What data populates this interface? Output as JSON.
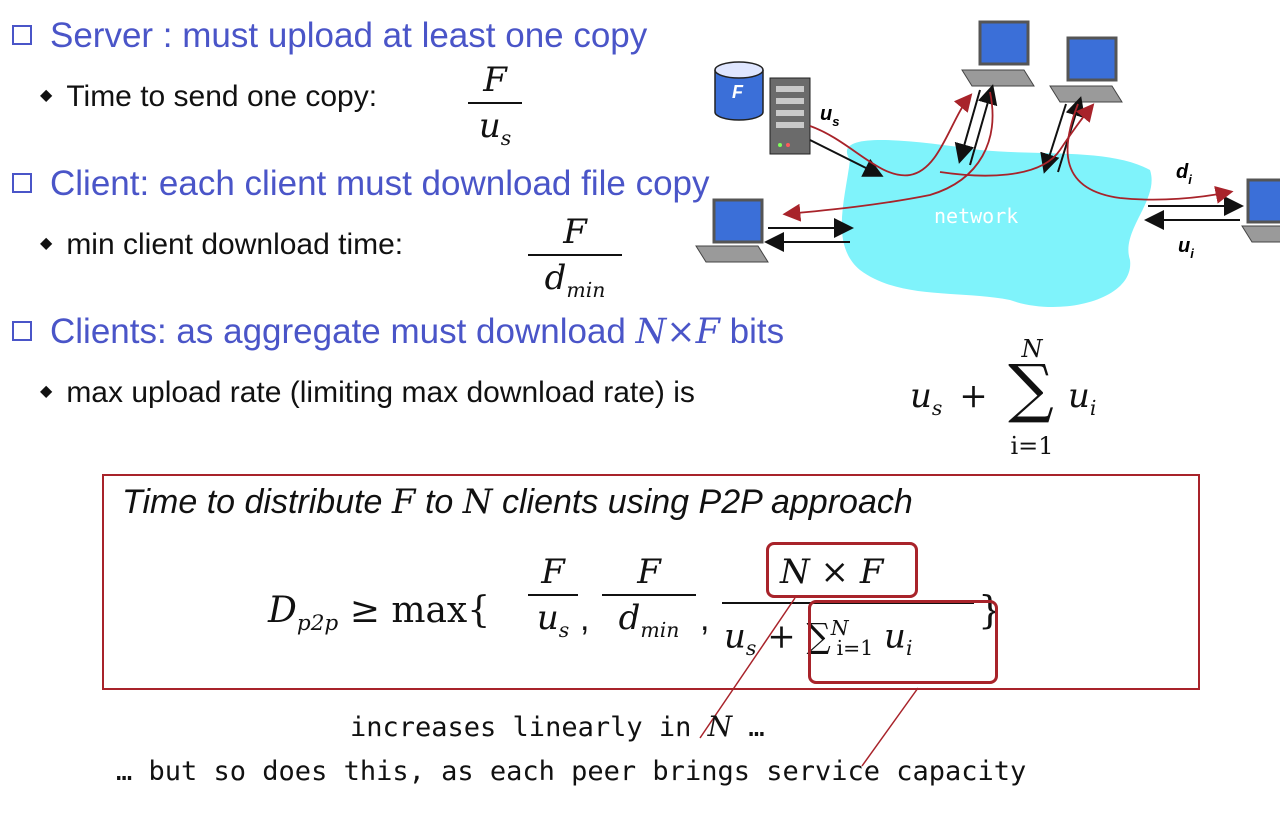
{
  "bullets": {
    "server_heading": "Server : must upload at least one copy",
    "server_sub": "Time to send one copy:",
    "client_heading": "Client: each client must download file copy",
    "client_sub": "min client download time:",
    "clients_heading_pre": "Clients: as aggregate must download",
    "clients_heading_math": "N×F",
    "clients_heading_post": "bits",
    "clients_sub": "max upload rate (limiting max download rate) is"
  },
  "formulas": {
    "f1_num": "F",
    "f1_den": "u",
    "f1_den_sub": "s",
    "f2_num": "F",
    "f2_den": "d",
    "f2_den_sub": "min",
    "sum_lhs": "u",
    "sum_lhs_sub": "s",
    "sum_plus": "+",
    "sum_sym": "∑",
    "sum_top": "N",
    "sum_bot": "i=1",
    "sum_term": "u",
    "sum_term_sub": "i"
  },
  "diagram": {
    "file_label": "F",
    "us_label": "u",
    "us_sub": "s",
    "di_label": "d",
    "di_sub": "i",
    "ui_label": "u",
    "ui_sub": "i",
    "network_label": "network",
    "colors": {
      "network": "#7ff3fb",
      "arrow_red": "#a8232a",
      "screen": "#3b6fd8"
    }
  },
  "result": {
    "title_pre": "Time to distribute",
    "title_f": "F",
    "title_mid": "to",
    "title_n": "N",
    "title_post": "clients using P2P approach",
    "D": "D",
    "D_sub": "p2p",
    "geq_max": "≥ max{",
    "t1_num": "F",
    "t1_den": "u",
    "t1_den_sub": "s",
    "t2_num": "F",
    "t2_den": "d",
    "t2_den_sub": "min",
    "t3_num": "N × F",
    "t3_den_u": "u",
    "t3_den_u_sub": "s",
    "t3_den_plus": "+",
    "t3_den_sum": "∑",
    "t3_den_sum_sup": "N",
    "t3_den_sum_sub": "i=1",
    "t3_den_term": "u",
    "t3_den_term_sub": "i",
    "close": "}",
    "border_color": "#a8232a"
  },
  "notes": {
    "line1_pre": "increases linearly in",
    "line1_n": "N",
    "line1_post": "…",
    "line2": "… but so does this, as each peer brings service capacity"
  }
}
